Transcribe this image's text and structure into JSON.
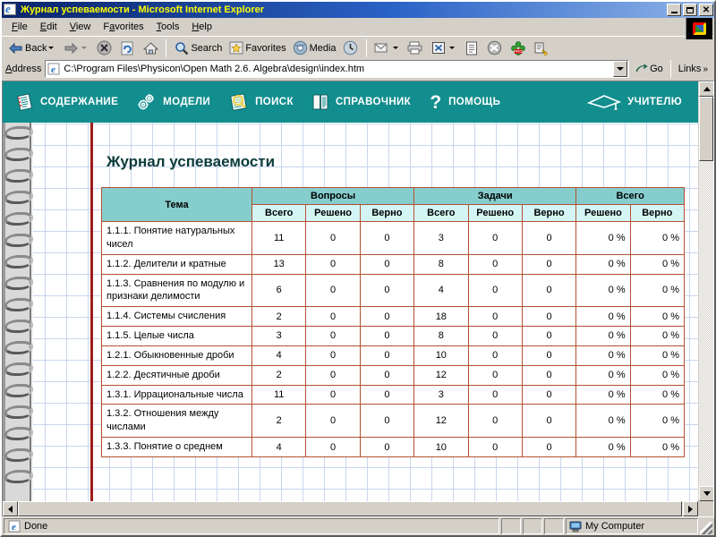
{
  "window": {
    "title": "Журнал успеваемости - Microsoft Internet Explorer",
    "icon": "ie-icon",
    "buttons": {
      "minimize": "_",
      "maximize": "□",
      "close": "✕"
    }
  },
  "menu": {
    "items": [
      {
        "label": "File",
        "accel": "F"
      },
      {
        "label": "Edit",
        "accel": "E"
      },
      {
        "label": "View",
        "accel": "V"
      },
      {
        "label": "Favorites",
        "accel": "a"
      },
      {
        "label": "Tools",
        "accel": "T"
      },
      {
        "label": "Help",
        "accel": "H"
      }
    ]
  },
  "toolbar": {
    "back_label": "Back",
    "forward_label": "",
    "search_label": "Search",
    "favorites_label": "Favorites",
    "media_label": "Media",
    "icons": [
      "back-icon",
      "forward-icon",
      "stop-icon",
      "refresh-icon",
      "home-icon",
      "search-icon",
      "favorites-icon",
      "media-icon",
      "history-icon",
      "mail-icon",
      "print-icon",
      "edit-excel-icon",
      "discuss-icon",
      "messenger-icon",
      "pro-icon",
      "research-icon"
    ]
  },
  "address": {
    "label": "Address",
    "value": "C:\\Program Files\\Physicon\\Open Math 2.6. Algebra\\design\\index.htm",
    "placeholder": "Address",
    "go_label": "Go",
    "links_label": "Links",
    "links_overflow": "»"
  },
  "nav": {
    "background": "#138e8e",
    "items": [
      {
        "label": "СОДЕРЖАНИЕ",
        "icon": "contents-book-icon"
      },
      {
        "label": "МОДЕЛИ",
        "icon": "gears-icon"
      },
      {
        "label": "ПОИСК",
        "icon": "magnifier-page-icon"
      },
      {
        "label": "СПРАВОЧНИК",
        "icon": "reference-book-icon"
      },
      {
        "label": "ПОМОЩЬ",
        "icon": "question-mark-icon"
      },
      {
        "label": "УЧИТЕЛЮ",
        "icon": "graduation-cap-icon"
      }
    ]
  },
  "page": {
    "title": "Журнал успеваемости",
    "table": {
      "group_headers": [
        {
          "label": "Тема",
          "span": 1,
          "rowspan": 2
        },
        {
          "label": "Вопросы",
          "span": 3
        },
        {
          "label": "Задачи",
          "span": 3
        },
        {
          "label": "Всего",
          "span": 2
        }
      ],
      "sub_headers": [
        "Всего",
        "Решено",
        "Верно",
        "Всего",
        "Решено",
        "Верно",
        "Решено",
        "Верно"
      ],
      "rows": [
        {
          "topic": "1.1.1. Понятие натуральных чисел",
          "cells": [
            "11",
            "0",
            "0",
            "3",
            "0",
            "0",
            "0 %",
            "0 %"
          ]
        },
        {
          "topic": "1.1.2. Делители и кратные",
          "cells": [
            "13",
            "0",
            "0",
            "8",
            "0",
            "0",
            "0 %",
            "0 %"
          ]
        },
        {
          "topic": "1.1.3. Сравнения по модулю и признаки делимости",
          "cells": [
            "6",
            "0",
            "0",
            "4",
            "0",
            "0",
            "0 %",
            "0 %"
          ]
        },
        {
          "topic": "1.1.4. Системы счисления",
          "cells": [
            "2",
            "0",
            "0",
            "18",
            "0",
            "0",
            "0 %",
            "0 %"
          ]
        },
        {
          "topic": "1.1.5. Целые числа",
          "cells": [
            "3",
            "0",
            "0",
            "8",
            "0",
            "0",
            "0 %",
            "0 %"
          ]
        },
        {
          "topic": "1.2.1. Обыкновенные дроби",
          "cells": [
            "4",
            "0",
            "0",
            "10",
            "0",
            "0",
            "0 %",
            "0 %"
          ]
        },
        {
          "topic": "1.2.2. Десятичные дроби",
          "cells": [
            "2",
            "0",
            "0",
            "12",
            "0",
            "0",
            "0 %",
            "0 %"
          ]
        },
        {
          "topic": "1.3.1. Иррациональные числа",
          "cells": [
            "11",
            "0",
            "0",
            "3",
            "0",
            "0",
            "0 %",
            "0 %"
          ]
        },
        {
          "topic": "1.3.2. Отношения между числами",
          "cells": [
            "2",
            "0",
            "0",
            "12",
            "0",
            "0",
            "0 %",
            "0 %"
          ]
        },
        {
          "topic": "1.3.3. Понятие о среднем",
          "cells": [
            "4",
            "0",
            "0",
            "10",
            "0",
            "0",
            "0 %",
            "0 %"
          ]
        }
      ]
    }
  },
  "status": {
    "text": "Done",
    "zone": "My Computer",
    "zone_icon": "computer-icon",
    "page_icon": "ie-icon"
  }
}
